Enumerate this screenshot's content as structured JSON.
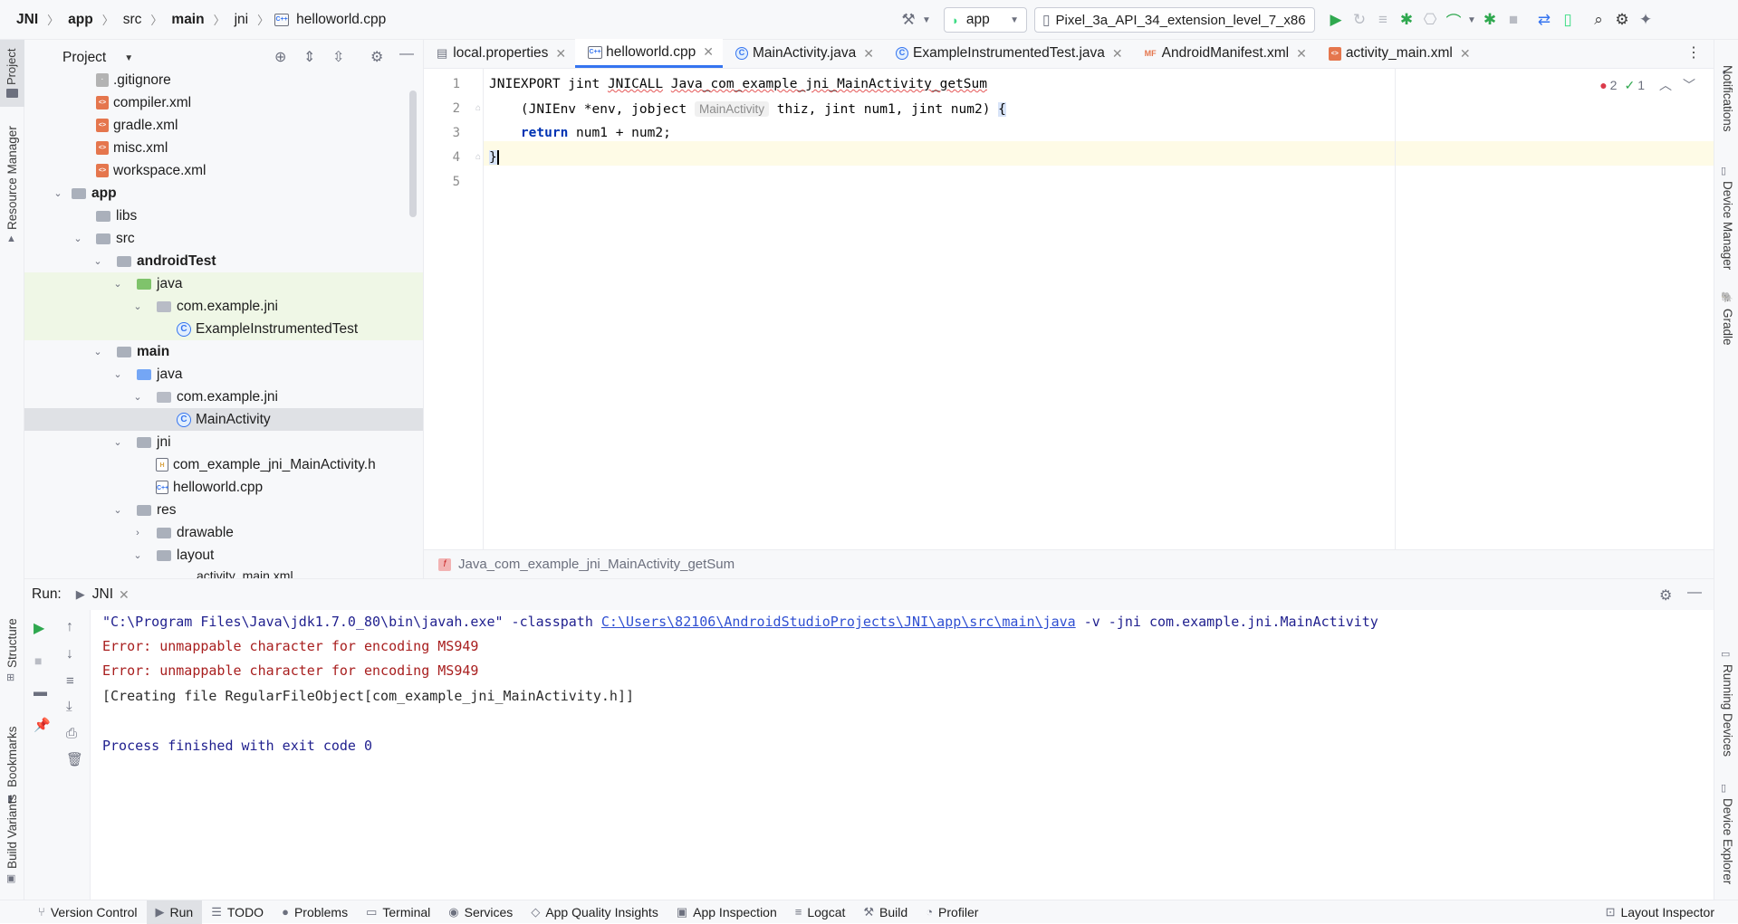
{
  "breadcrumb": [
    "JNI",
    "app",
    "src",
    "main",
    "jni",
    "helloworld.cpp"
  ],
  "toolbar": {
    "config": "app",
    "device": "Pixel_3a_API_34_extension_level_7_x86..."
  },
  "left_strip": [
    "Project",
    "Resource Manager",
    "Structure",
    "Bookmarks",
    "Build Variants"
  ],
  "right_strip": [
    "Notifications",
    "Device Manager",
    "Gradle",
    "Running Devices",
    "Device Explorer"
  ],
  "project_panel": {
    "title": "Project",
    "tree": [
      {
        "label": ".gitignore",
        "icon": "git"
      },
      {
        "label": "compiler.xml",
        "icon": "xml"
      },
      {
        "label": "gradle.xml",
        "icon": "xml"
      },
      {
        "label": "misc.xml",
        "icon": "xml"
      },
      {
        "label": "workspace.xml",
        "icon": "xml"
      },
      {
        "label": "app",
        "icon": "folder"
      },
      {
        "label": "libs",
        "icon": "folder"
      },
      {
        "label": "src",
        "icon": "folder"
      },
      {
        "label": "androidTest",
        "icon": "folder"
      },
      {
        "label": "java",
        "icon": "folder"
      },
      {
        "label": "com.example.jni",
        "icon": "package"
      },
      {
        "label": "ExampleInstrumentedTest",
        "icon": "class"
      },
      {
        "label": "main",
        "icon": "folder"
      },
      {
        "label": "java",
        "icon": "folder"
      },
      {
        "label": "com.example.jni",
        "icon": "package"
      },
      {
        "label": "MainActivity",
        "icon": "class"
      },
      {
        "label": "jni",
        "icon": "folder"
      },
      {
        "label": "com_example_jni_MainActivity.h",
        "icon": "h"
      },
      {
        "label": "helloworld.cpp",
        "icon": "cpp"
      },
      {
        "label": "res",
        "icon": "folder"
      },
      {
        "label": "drawable",
        "icon": "folder"
      },
      {
        "label": "layout",
        "icon": "folder"
      },
      {
        "label": "activity_main.xml",
        "icon": "xml"
      }
    ]
  },
  "editor": {
    "tabs": [
      "local.properties",
      "helloworld.cpp",
      "MainActivity.java",
      "ExampleInstrumentedTest.java",
      "AndroidManifest.xml",
      "activity_main.xml"
    ],
    "active_tab": "helloworld.cpp",
    "line_numbers": [
      "1",
      "2",
      "3",
      "4",
      "5"
    ],
    "code": {
      "l1_a": "JNIEXPORT jint ",
      "l1_b": "JNICALL",
      "l1_c": " ",
      "l1_d": "Java_com_example_jni_MainActivity_getSum",
      "l2_a": "    (JNIEnv *env, jobject ",
      "l2_hint": "MainActivity",
      "l2_b": " thiz, jint num1, jint num2) ",
      "l2_brace": "{",
      "l3_kw": "    return",
      "l3_b": " num1 + num2;",
      "l4": "}"
    },
    "inspections": {
      "errors": "2",
      "warnings": "1"
    },
    "function_breadcrumb": "Java_com_example_jni_MainActivity_getSum"
  },
  "run_panel": {
    "label": "Run:",
    "tab": "JNI",
    "console": {
      "cmd_a": "\"C:\\Program Files\\Java\\jdk1.7.0_80\\bin\\javah.exe\" -classpath ",
      "cmd_link": "C:\\Users\\82106\\AndroidStudioProjects\\JNI\\app\\src\\main\\java",
      "cmd_b": " -v -jni com.example.jni.MainActivity",
      "err1": "Error: unmappable character for encoding MS949",
      "err2": "Error: unmappable character for encoding MS949",
      "created": "[Creating file RegularFileObject[com_example_jni_MainActivity.h]]",
      "finished": "Process finished with exit code 0"
    }
  },
  "bottom_bar": [
    "Version Control",
    "Run",
    "TODO",
    "Problems",
    "Terminal",
    "Services",
    "App Quality Insights",
    "App Inspection",
    "Logcat",
    "Build",
    "Profiler",
    "Layout Inspector"
  ],
  "colors": {
    "accent": "#3574f0",
    "error": "#a81e1e",
    "run_green": "#2fa84f"
  }
}
